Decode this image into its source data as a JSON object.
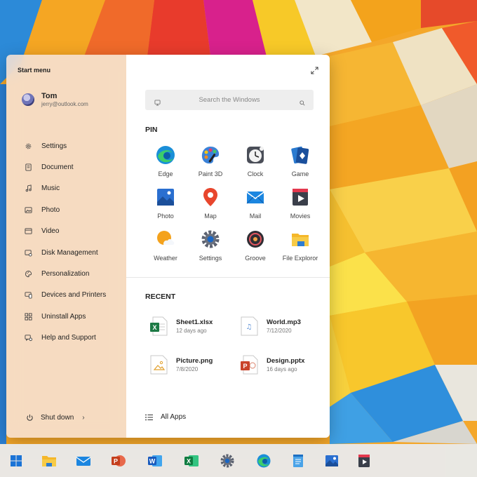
{
  "start_menu": {
    "title": "Start menu",
    "user": {
      "name": "Tom",
      "email": "jerry@outlook.com"
    },
    "nav_items": [
      {
        "label": "Settings",
        "icon": "gear-icon"
      },
      {
        "label": "Document",
        "icon": "document-icon"
      },
      {
        "label": "Music",
        "icon": "music-icon"
      },
      {
        "label": "Photo",
        "icon": "photo-icon"
      },
      {
        "label": "Video",
        "icon": "video-icon"
      },
      {
        "label": "Disk Management",
        "icon": "disk-icon"
      },
      {
        "label": "Personalization",
        "icon": "palette-icon"
      },
      {
        "label": "Devices and Printers",
        "icon": "devices-icon"
      },
      {
        "label": "Uninstall Apps",
        "icon": "apps-icon"
      },
      {
        "label": "Help and Support",
        "icon": "help-icon"
      }
    ],
    "shutdown_label": "Shut down",
    "search_placeholder": "Search the Windows",
    "pin_title": "PIN",
    "pinned": [
      {
        "label": "Edge",
        "icon": "edge-icon"
      },
      {
        "label": "Paint 3D",
        "icon": "paint3d-icon"
      },
      {
        "label": "Clock",
        "icon": "clock-icon"
      },
      {
        "label": "Game",
        "icon": "game-icon"
      },
      {
        "label": "Photo",
        "icon": "photos-icon"
      },
      {
        "label": "Map",
        "icon": "map-icon"
      },
      {
        "label": "Mail",
        "icon": "mail-icon"
      },
      {
        "label": "Movies",
        "icon": "movies-icon"
      },
      {
        "label": "Weather",
        "icon": "weather-icon"
      },
      {
        "label": "Settings",
        "icon": "settings-icon"
      },
      {
        "label": "Groove",
        "icon": "groove-icon"
      },
      {
        "label": "File Exploror",
        "icon": "folder-icon"
      }
    ],
    "recent_title": "RECENT",
    "recent": [
      {
        "name": "Sheet1.xlsx",
        "meta": "12 days ago",
        "icon": "excel-file-icon"
      },
      {
        "name": "World.mp3",
        "meta": "7/12/2020",
        "icon": "audio-file-icon"
      },
      {
        "name": "Picture.png",
        "meta": "7/8/2020",
        "icon": "image-file-icon"
      },
      {
        "name": "Design.pptx",
        "meta": "16 days ago",
        "icon": "powerpoint-file-icon"
      }
    ],
    "all_apps_label": "All Apps"
  },
  "taskbar": {
    "items": [
      "windows-logo-icon",
      "file-explorer-icon",
      "mail-icon",
      "powerpoint-icon",
      "word-icon",
      "excel-icon",
      "settings-icon",
      "edge-icon",
      "notepad-icon",
      "photos-icon",
      "movies-icon"
    ]
  },
  "colors": {
    "accent_blue": "#1a73d6",
    "left_pane": "#f6e2d6",
    "taskbar": "#e8edf3"
  }
}
